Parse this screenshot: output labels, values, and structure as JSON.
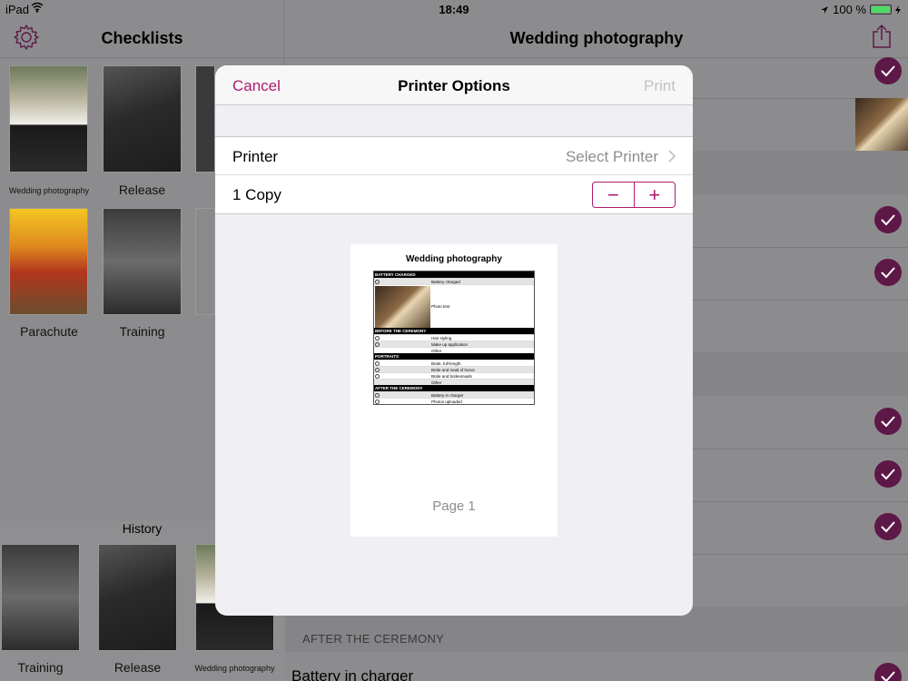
{
  "status_bar": {
    "device": "iPad",
    "time": "18:49",
    "battery": "100 %"
  },
  "left": {
    "title": "Checklists",
    "checklists": [
      {
        "label": "Wedding photography"
      },
      {
        "label": "Release"
      },
      {
        "label": "Parachute"
      },
      {
        "label": "Training"
      }
    ],
    "history_title": "History",
    "history": [
      {
        "label": "Training"
      },
      {
        "label": "Release"
      },
      {
        "label": "Wedding photography"
      }
    ]
  },
  "right": {
    "title": "Wedding photography",
    "section_after": "AFTER THE CEREMONY",
    "row_last": "Battery in charger"
  },
  "modal": {
    "cancel": "Cancel",
    "title": "Printer Options",
    "print": "Print",
    "printer_label": "Printer",
    "printer_value": "Select Printer",
    "copies_label": "1 Copy",
    "preview": {
      "title": "Wedding photography",
      "page_label": "Page 1",
      "sections": [
        {
          "name": "BATTERY CHARGED",
          "items": [
            "Battery charged",
            "Photo test"
          ]
        },
        {
          "name": "BEFORE THE CEREMONY",
          "items": [
            "Hair styling",
            "Make up application",
            "Other"
          ]
        },
        {
          "name": "PORTRAITS",
          "items": [
            "Bride, full-length",
            "Bride and maid of honor",
            "Bride and bridesmaids",
            "Other"
          ]
        },
        {
          "name": "AFTER THE CEREMONY",
          "items": [
            "Battery in charger",
            "Photos uploaded"
          ]
        }
      ]
    }
  },
  "colors": {
    "accent": "#b01a6f",
    "check": "#5e1848"
  }
}
